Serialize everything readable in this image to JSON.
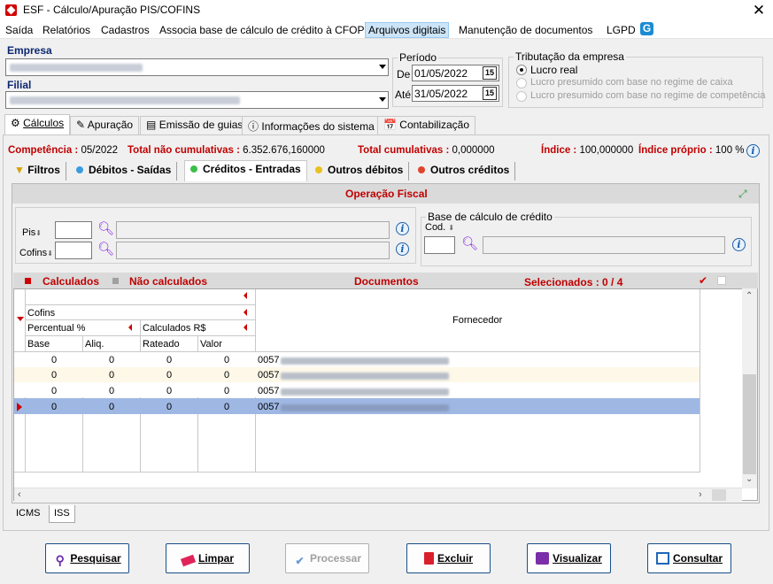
{
  "window": {
    "title": "ESF - Cálculo/Apuração PIS/COFINS"
  },
  "menu": [
    "Saída",
    "Relatórios",
    "Cadastros",
    "Associa base de cálculo de crédito à CFOP",
    "Arquivos digitais",
    "Manutenção de documentos",
    "LGPD"
  ],
  "empresa": {
    "label": "Empresa"
  },
  "filial": {
    "label": "Filial"
  },
  "periodo": {
    "legend": "Período",
    "de_label": "De",
    "de_value": "01/05/2022",
    "ate_label": "Até",
    "ate_value": "31/05/2022",
    "cal_icon_text": "15"
  },
  "tributacao": {
    "legend": "Tributação da empresa",
    "options": [
      "Lucro real",
      "Lucro presumido com base no regime de caixa",
      "Lucro presumido com base no regime de competência"
    ],
    "selected": 0
  },
  "tabs": [
    "Cálculos",
    "Apuração",
    "Emissão de guias",
    "Informações do sistema",
    "Contabilização"
  ],
  "summary": {
    "competencia_label": "Competência :",
    "competencia_value": "05/2022",
    "total_nao_cum_label": "Total não cumulativas :",
    "total_nao_cum_value": "6.352.676,160000",
    "total_cum_label": "Total cumulativas :",
    "total_cum_value": "0,000000",
    "indice_label": "Índice :",
    "indice_value": "100,000000",
    "indice_proprio_label": "Índice próprio :",
    "indice_proprio_value": "100 %"
  },
  "subtabs": [
    "Filtros",
    "Débitos - Saídas",
    "Créditos - Entradas",
    "Outros débitos",
    "Outros créditos"
  ],
  "operacao": {
    "title": "Operação Fiscal",
    "pis_label": "Pis",
    "cofins_label": "Cofins",
    "base_legend": "Base de cálculo de crédito",
    "cod_label": "Cod."
  },
  "grid": {
    "calculados_label": "Calculados",
    "nao_calculados_label": "Não calculados",
    "documentos_label": "Documentos",
    "selecionados_label": "Selecionados : 0 / 4",
    "col_cofins": "Cofins",
    "col_percentual": "Percentual %",
    "col_calculados": "Calculados R$",
    "col_base": "Base",
    "col_aliq": "Aliq.",
    "col_rateado": "Rateado",
    "col_valor": "Valor",
    "col_fornecedor": "Fornecedor",
    "rows": [
      {
        "base": "0",
        "aliq": "0",
        "rateado": "0",
        "valor": "0",
        "fornecedor": "0057"
      },
      {
        "base": "0",
        "aliq": "0",
        "rateado": "0",
        "valor": "0",
        "fornecedor": "0057"
      },
      {
        "base": "0",
        "aliq": "0",
        "rateado": "0",
        "valor": "0",
        "fornecedor": "0057"
      },
      {
        "base": "0",
        "aliq": "0",
        "rateado": "0",
        "valor": "0",
        "fornecedor": "0057"
      }
    ]
  },
  "bottom_tabs": [
    "ICMS",
    "ISS"
  ],
  "buttons": [
    "Pesquisar",
    "Limpar",
    "Processar",
    "Excluir",
    "Visualizar",
    "Consultar"
  ],
  "colors": {
    "accent_red": "#c00000",
    "label_blue": "#0c2770",
    "row_selected": "#9fb7e3",
    "row_alt": "#fdf8e8"
  }
}
